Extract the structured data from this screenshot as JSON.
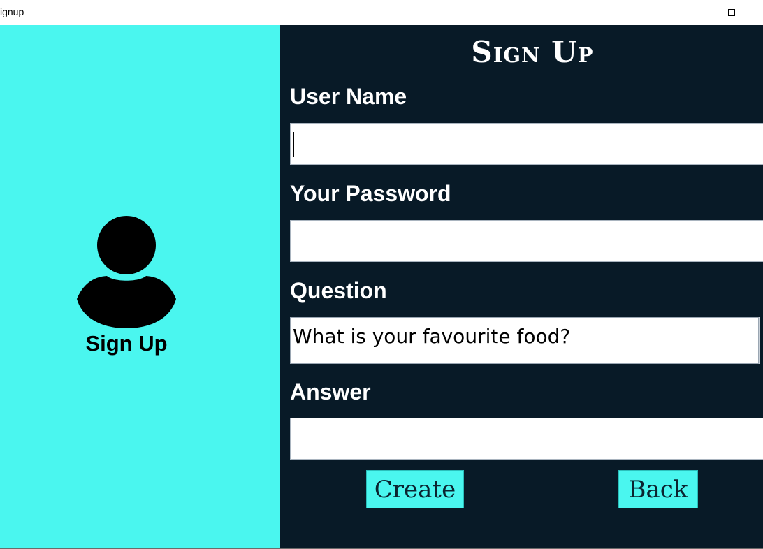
{
  "window": {
    "title": "ignup",
    "controls": [
      "minimize-icon",
      "maximize-icon"
    ]
  },
  "left_panel": {
    "background": "#4af6ef",
    "icon": "user-avatar-icon",
    "caption": "Sign Up"
  },
  "form": {
    "background": "#081a27",
    "title": "Sign Up",
    "username": {
      "label": "User Name",
      "value": ""
    },
    "password": {
      "label": "Your Password",
      "value": ""
    },
    "question": {
      "label": "Question",
      "selected": "What is your favourite food?"
    },
    "answer": {
      "label": "Answer",
      "value": ""
    },
    "create_label": "Create",
    "back_label": "Back"
  }
}
